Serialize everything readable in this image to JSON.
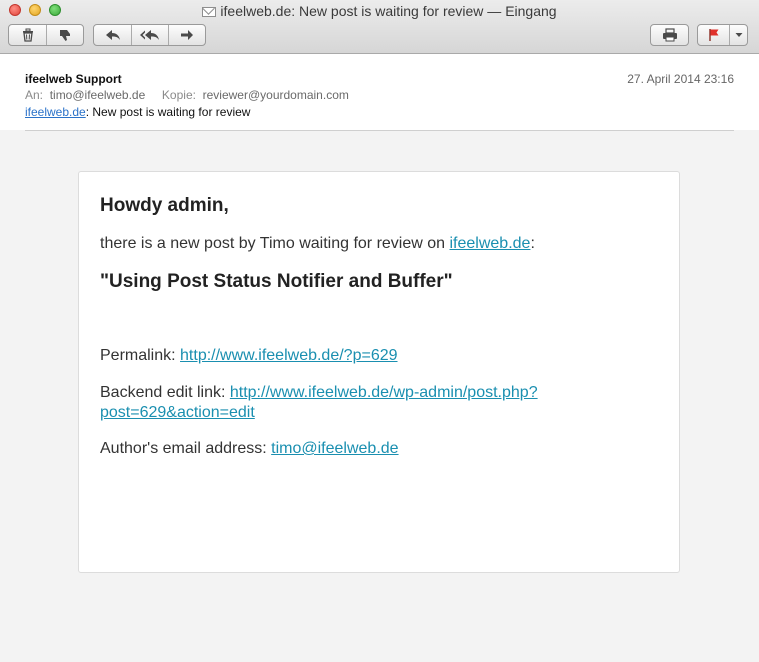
{
  "window": {
    "title": "ifeelweb.de: New post is waiting for review — Eingang"
  },
  "toolbar": {
    "delete_icon": "trash-icon",
    "junk_icon": "thumbs-down-icon",
    "reply_icon": "reply-arrow-icon",
    "reply_all_icon": "reply-all-icon",
    "forward_icon": "forward-arrow-icon",
    "print_icon": "printer-icon",
    "flag_icon": "flag-icon",
    "flag_color": "#e0312b"
  },
  "message": {
    "from": "ifeelweb Support",
    "date": "27. April 2014 23:16",
    "to_label": "An:",
    "to": "timo@ifeelweb.de",
    "cc_label": "Kopie:",
    "cc": "reviewer@yourdomain.com",
    "subject_link": "ifeelweb.de",
    "subject_rest": ": New post is waiting for review"
  },
  "body": {
    "greeting": "Howdy admin,",
    "intro_text": "there is a new post by Timo waiting for review on ",
    "intro_link": "ifeelweb.de",
    "intro_end": ":",
    "post_title": "\"Using Post Status Notifier and Buffer\"",
    "permalink_label": "Permalink: ",
    "permalink_url": "http://www.ifeelweb.de/?p=629",
    "edit_label": "Backend edit link: ",
    "edit_url_line1": "http://www.ifeelweb.de/wp-admin/post.php?",
    "edit_url_line2": "post=629&action=edit",
    "email_label": "Author's email address: ",
    "email": "timo@ifeelweb.de"
  }
}
